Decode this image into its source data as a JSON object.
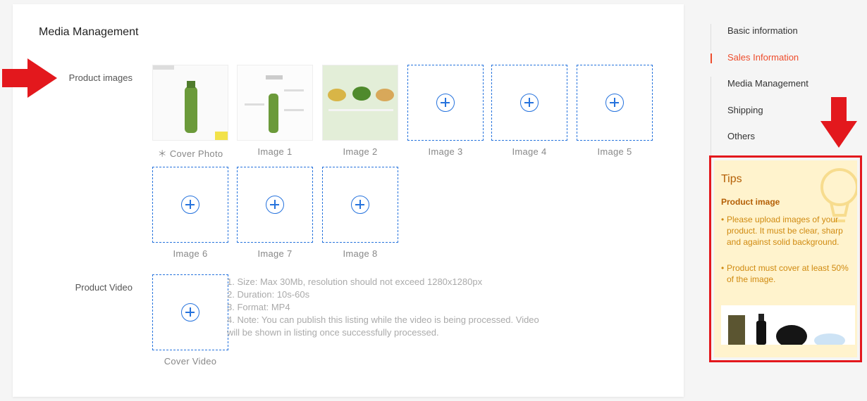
{
  "section": {
    "title": "Media Management"
  },
  "product_images": {
    "label": "Product images",
    "slots": [
      {
        "label": "＊ Cover Photo"
      },
      {
        "label": "Image  1"
      },
      {
        "label": "Image  2"
      },
      {
        "label": "Image  3"
      },
      {
        "label": "Image  4"
      },
      {
        "label": "Image  5"
      },
      {
        "label": "Image  6"
      },
      {
        "label": "Image  7"
      },
      {
        "label": "Image  8"
      }
    ]
  },
  "product_video": {
    "label": "Product Video",
    "slot_label": "Cover Video",
    "notes": [
      "1. Size: Max 30Mb, resolution should not exceed 1280x1280px",
      "2. Duration: 10s-60s",
      "3. Format: MP4",
      "4. Note: You can publish this listing while the video is being processed. Video will be shown in listing once successfully processed."
    ]
  },
  "nav": {
    "items": [
      {
        "label": "Basic information"
      },
      {
        "label": "Sales Information"
      },
      {
        "label": "Media Management"
      },
      {
        "label": "Shipping"
      },
      {
        "label": "Others"
      }
    ],
    "active": "Sales Information"
  },
  "tips": {
    "title": "Tips",
    "subtitle": "Product image",
    "items": [
      "Please upload images of your product. It must be clear, sharp and against solid background.",
      "Product must cover at least 50% of the image."
    ]
  },
  "colors": {
    "accent": "#ee4d2d",
    "dashed_border": "#2673dd",
    "annotation_red": "#e3181d",
    "tips_bg": "#fff3cd"
  },
  "icons": {
    "add": "plus-circle-icon",
    "annotation": "red-arrow-icon",
    "tip": "lightbulb-icon"
  }
}
